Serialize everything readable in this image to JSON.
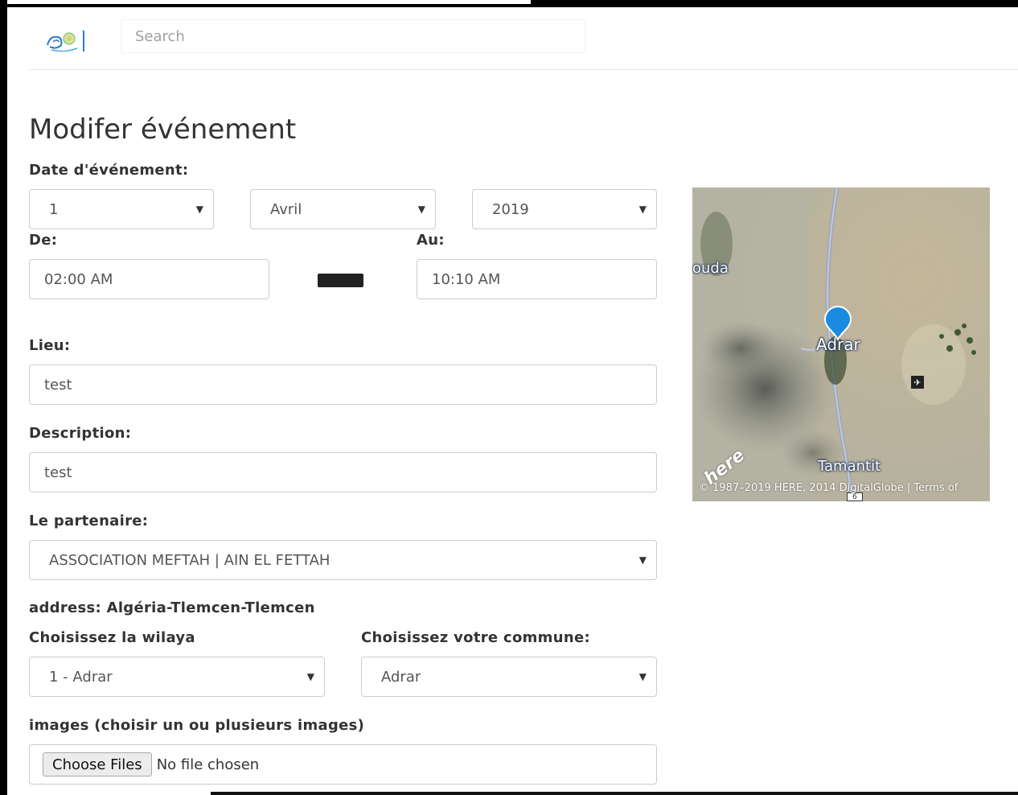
{
  "header": {
    "search_placeholder": "Search",
    "logo_icon": "logo-icon"
  },
  "page": {
    "title": "Modifer événement"
  },
  "form": {
    "date_label": "Date d'événement:",
    "day": "1",
    "month": "Avril",
    "year": "2019",
    "from_label": "De:",
    "from_time": "02:00 AM",
    "to_label": "Au:",
    "to_time": "10:10 AM",
    "place_label": "Lieu:",
    "place_value": "test",
    "description_label": "Description:",
    "description_value": "test",
    "partner_label": "Le partenaire:",
    "partner_value": "ASSOCIATION MEFTAH | AIN EL FETTAH",
    "address_text": "address: Algéria-Tlemcen-Tlemcen",
    "wilaya_label": "Choisissez la wilaya",
    "wilaya_value": "1 - Adrar",
    "commune_label": "Choisissez votre commune:",
    "commune_value": "Adrar",
    "images_label": "images (choisir un ou plusieurs images)",
    "choose_files": "Choose Files",
    "no_file": "No file chosen"
  },
  "map": {
    "label_left": "ouda",
    "label_center": "Adrar",
    "label_bottom": "Tamantit",
    "brand": "here",
    "copyright": "© 1987–2019 HERE, 2014 DigitalGlobe | Terms of",
    "route_number": "6",
    "pin_color": "#1a8be0",
    "icons": [
      "map-pin-icon",
      "airport-icon"
    ]
  }
}
